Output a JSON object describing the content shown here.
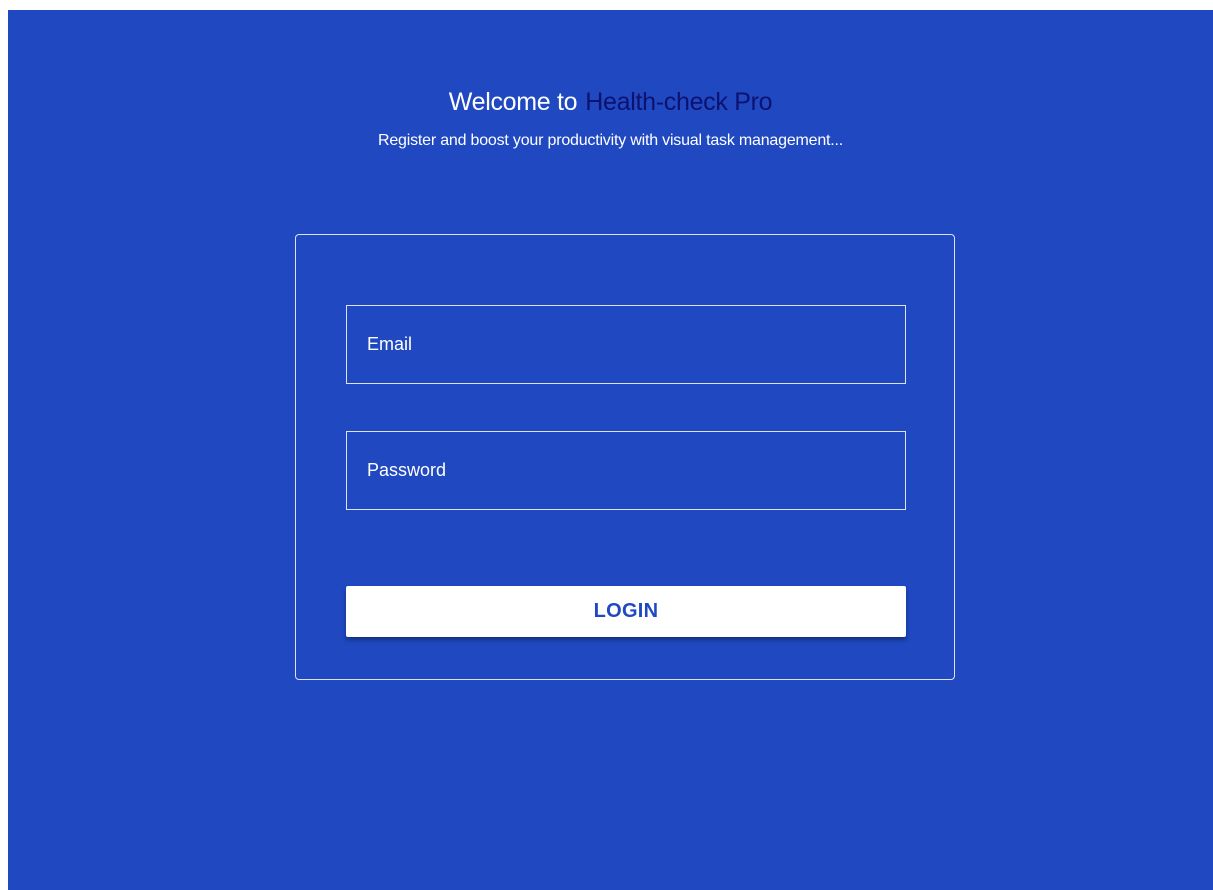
{
  "header": {
    "welcome_prefix": "Welcome to",
    "brand_name": "Health-check Pro",
    "tagline": "Register and  boost your productivity with visual task management..."
  },
  "login_form": {
    "email_placeholder": "Email",
    "password_placeholder": "Password",
    "login_label": "LOGIN"
  },
  "colors": {
    "background": "#1f48c1",
    "brand_text": "#0d1270",
    "button_background": "#ffffff",
    "button_text": "#1f48c1"
  }
}
